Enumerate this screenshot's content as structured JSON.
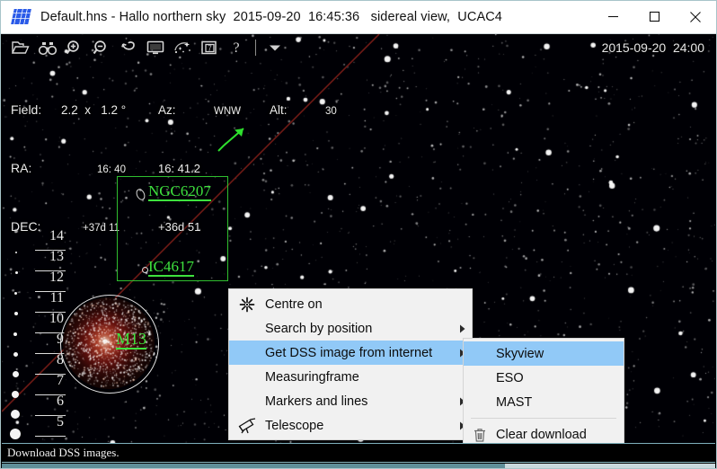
{
  "window": {
    "title": "Default.hns - Hallo northern sky  2015-09-20  16:45:36   sidereal view,  UCAC4",
    "app_icon": "sky-grid-icon",
    "minimize_label": "Minimize",
    "maximize_label": "Maximize",
    "close_label": "Close"
  },
  "toolbar": {
    "datetime": "2015-09-20  24:00",
    "buttons": [
      {
        "name": "open-file-button",
        "icon": "open-folder-icon",
        "tooltip": "Open"
      },
      {
        "name": "search-button",
        "icon": "binoculars-icon",
        "tooltip": "Search"
      },
      {
        "name": "zoom-in-button",
        "icon": "zoom-in-icon",
        "tooltip": "Zoom in"
      },
      {
        "name": "zoom-out-button",
        "icon": "zoom-out-icon",
        "tooltip": "Zoom out"
      },
      {
        "name": "undo-button",
        "icon": "undo-arrow-icon",
        "tooltip": "Undo"
      },
      {
        "name": "fullscreen-button",
        "icon": "monitor-icon",
        "tooltip": "Screen"
      },
      {
        "name": "deepsky-button",
        "icon": "sparkle-stars-icon",
        "tooltip": "Deep sky"
      },
      {
        "name": "calendar-button",
        "icon": "calendar-7-icon",
        "tooltip": "Date"
      },
      {
        "name": "help-button",
        "icon": "question-mark-icon",
        "tooltip": "Help"
      },
      {
        "name": "more-button",
        "icon": "chevron-down-icon",
        "tooltip": "More"
      }
    ]
  },
  "info": {
    "field_label": "Field:",
    "field_value": "2.2  x   1.2 °",
    "az_label": "Az:",
    "az_value": "WNW",
    "alt_label": "Alt:",
    "alt_value": "30",
    "ra_label": "RA:",
    "ra_value1": "16: 40",
    "ra_value2": "16: 41.2",
    "dec_label": "DEC:",
    "dec_value1": "+37d 11",
    "dec_value2": "+36d 51"
  },
  "sky": {
    "magnitude_scale": [
      "14",
      "13",
      "12",
      "11",
      "10",
      "9",
      "8",
      "7",
      "6",
      "5"
    ],
    "objects": [
      {
        "name": "NGC6207",
        "label": "NGC6207"
      },
      {
        "name": "IC4617",
        "label": "IC4617"
      },
      {
        "name": "M13",
        "label": "M13"
      }
    ],
    "label_color": "#3ee23e",
    "frame_color": "#2fbe2f"
  },
  "context_menu": {
    "items": [
      {
        "name": "centre-on",
        "label": "Centre on",
        "icon": "centre-asterisk-icon",
        "submenu": false,
        "selected": false
      },
      {
        "name": "search-by-position",
        "label": "Search by position",
        "icon": "",
        "submenu": true,
        "selected": false
      },
      {
        "name": "get-dss-image",
        "label": "Get DSS image from internet",
        "icon": "",
        "submenu": true,
        "selected": true
      },
      {
        "name": "measuringframe",
        "label": "Measuringframe",
        "icon": "",
        "submenu": false,
        "selected": false
      },
      {
        "name": "markers-and-lines",
        "label": "Markers and lines",
        "icon": "",
        "submenu": true,
        "selected": false
      },
      {
        "name": "telescope",
        "label": "Telescope",
        "icon": "telescope-icon",
        "submenu": true,
        "selected": false
      }
    ]
  },
  "submenu": {
    "items": [
      {
        "name": "skyview",
        "label": "Skyview",
        "icon": "",
        "selected": true,
        "separator_before": false
      },
      {
        "name": "eso",
        "label": "ESO",
        "icon": "",
        "selected": false,
        "separator_before": false
      },
      {
        "name": "mast",
        "label": "MAST",
        "icon": "",
        "selected": false,
        "separator_before": false
      },
      {
        "name": "clear-download",
        "label": "Clear  download",
        "icon": "trash-icon",
        "selected": false,
        "separator_before": true
      }
    ]
  },
  "statusbar": {
    "message": "Download DSS images."
  },
  "colors": {
    "menu_highlight": "#91c9f7",
    "menu_background": "#f1f1f1",
    "sky_background": "#000005",
    "green_label": "#3ee23e",
    "status_text": "#f2f2f2"
  }
}
